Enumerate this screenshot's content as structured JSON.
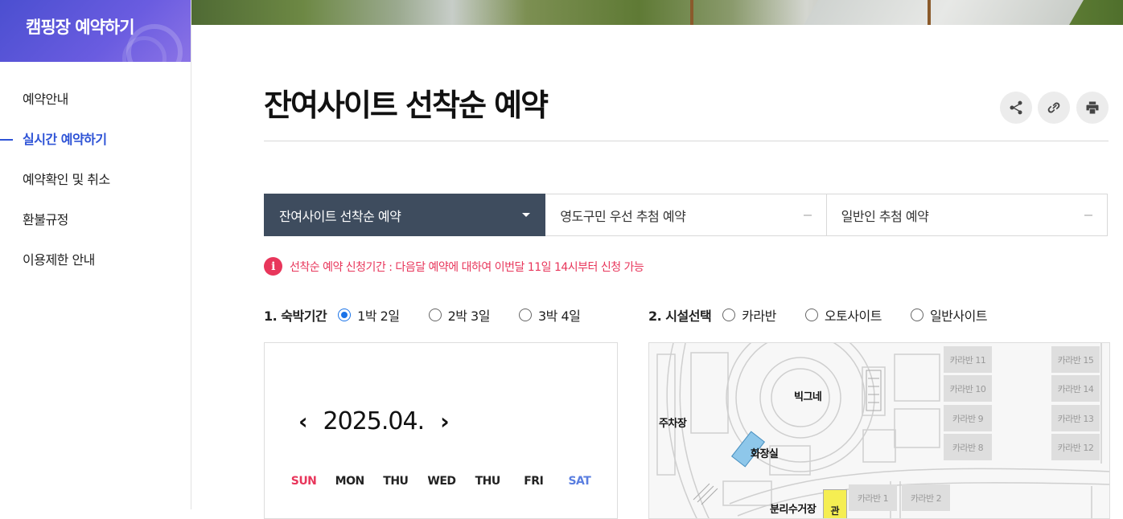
{
  "sidebar": {
    "title": "캠핑장 예약하기",
    "items": [
      {
        "label": "예약안내",
        "active": false
      },
      {
        "label": "실시간 예약하기",
        "active": true
      },
      {
        "label": "예약확인 및 취소",
        "active": false
      },
      {
        "label": "환불규정",
        "active": false
      },
      {
        "label": "이용제한 안내",
        "active": false
      }
    ]
  },
  "header": {
    "title": "잔여사이트 선착순 예약",
    "utils": [
      "share-icon",
      "link-icon",
      "print-icon"
    ]
  },
  "tabs": [
    {
      "label": "잔여사이트 선착순 예약",
      "active": true
    },
    {
      "label": "영도구민 우선 추첨 예약",
      "active": false
    },
    {
      "label": "일반인 추첨 예약",
      "active": false
    }
  ],
  "notice": {
    "icon": "i",
    "text": "선착순 예약 신청기간 : 다음달 예약에 대하여 이번달 11일 14시부터 신청 가능"
  },
  "stay": {
    "label": "1. 숙박기간",
    "options": [
      {
        "label": "1박 2일",
        "selected": true
      },
      {
        "label": "2박 3일",
        "selected": false
      },
      {
        "label": "3박 4일",
        "selected": false
      }
    ]
  },
  "facility": {
    "label": "2. 시설선택",
    "options": [
      {
        "label": "카라반",
        "selected": false
      },
      {
        "label": "오토사이트",
        "selected": false
      },
      {
        "label": "일반사이트",
        "selected": false
      }
    ]
  },
  "calendar": {
    "prev": "‹",
    "next": "›",
    "month": "2025.04.",
    "weekdays": [
      "SUN",
      "MON",
      "THU",
      "WED",
      "THU",
      "FRI",
      "SAT"
    ]
  },
  "map": {
    "labels": {
      "bignet": "빅그네",
      "parking": "주차장",
      "toilet": "화장실",
      "recycle": "분리수거장",
      "kwan": "관"
    },
    "sites": {
      "k11": "카라반 11",
      "k15": "카라반 15",
      "k10": "카라반 10",
      "k14": "카라반 14",
      "k9": "카라반 9",
      "k13": "카라반 13",
      "k8": "카라반 8",
      "k12": "카라반 12",
      "k1": "카라반 1",
      "k2": "카라반 2"
    }
  },
  "colors": {
    "accent": "#2e53d6",
    "tab_active": "#3e4c5e",
    "notice": "#e8365b",
    "sat": "#5a7ee0"
  }
}
